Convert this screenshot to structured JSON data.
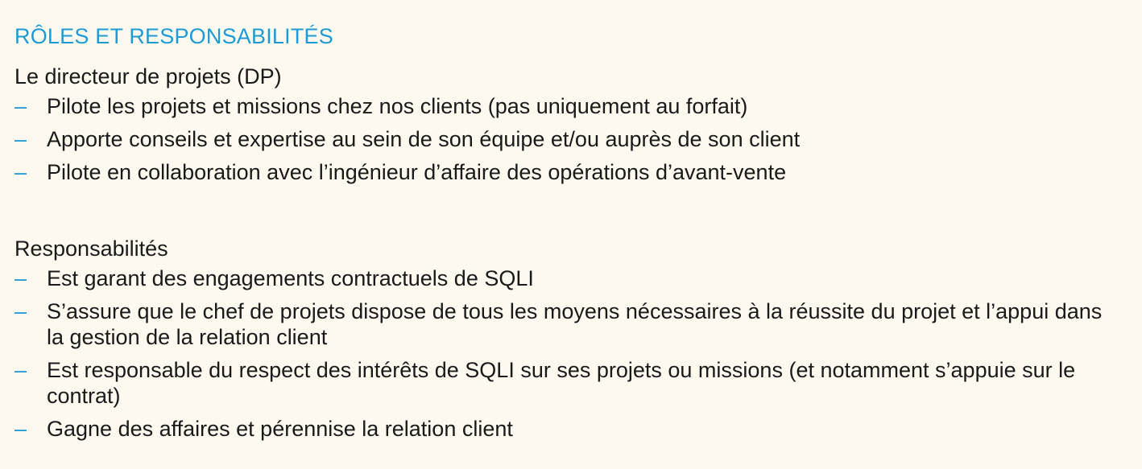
{
  "title": "RÔLES ET RESPONSABILITÉS",
  "roles": {
    "heading": "Le directeur de projets (DP)",
    "items": [
      "Pilote les projets et missions chez nos clients (pas uniquement au forfait)",
      "Apporte conseils et expertise au sein de son équipe et/ou auprès de son client",
      "Pilote en collaboration avec l’ingénieur d’affaire des opérations d’avant-vente"
    ]
  },
  "responsibilities": {
    "heading": "Responsabilités",
    "items": [
      "Est garant des engagements contractuels de SQLI",
      "S’assure que le chef de projets dispose de tous les moyens nécessaires à la réussite du projet et l’appui dans la gestion de la relation client",
      "Est responsable du respect des intérêts de SQLI sur ses projets ou missions (et notamment s’appuie sur le contrat)",
      "Gagne des affaires et pérennise la relation client"
    ]
  },
  "bullet_symbol": "–",
  "colors": {
    "accent": "#1e9bd7",
    "background": "#fdf9ef",
    "text": "#1a1a1a"
  }
}
